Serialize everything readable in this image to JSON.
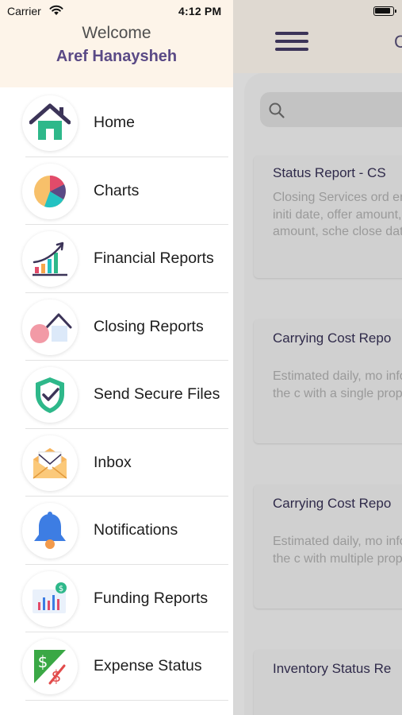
{
  "status_bar": {
    "carrier": "Carrier",
    "time": "4:12 PM"
  },
  "drawer": {
    "welcome": "Welcome",
    "user_name": "Aref Hanaysheh",
    "items": [
      {
        "label": "Home",
        "icon": "home-icon"
      },
      {
        "label": "Charts",
        "icon": "pie-chart-icon"
      },
      {
        "label": "Financial Reports",
        "icon": "bar-chart-growth-icon"
      },
      {
        "label": "Closing Reports",
        "icon": "house-closing-icon"
      },
      {
        "label": "Send Secure Files",
        "icon": "shield-check-icon"
      },
      {
        "label": "Inbox",
        "icon": "envelope-icon"
      },
      {
        "label": "Notifications",
        "icon": "bell-icon"
      },
      {
        "label": "Funding Reports",
        "icon": "funding-chart-icon"
      },
      {
        "label": "Expense Status",
        "icon": "expense-dollar-icon"
      }
    ]
  },
  "main": {
    "title": "C",
    "cards": [
      {
        "title": "Status Report - CS",
        "description": "Closing Services ord employee name, initi date, offer amount, a resale amount, sche close date."
      },
      {
        "title": "Carrying Cost Repo",
        "description": "Estimated daily, mo information on the c with a single proper"
      },
      {
        "title": "Carrying Cost Repo",
        "description": "Estimated daily, mo information on the c with multiple prope"
      },
      {
        "title": "Inventory Status Re",
        "description": ""
      }
    ]
  },
  "colors": {
    "accent": "#5a4a86",
    "header_bg": "#fdf4e9",
    "nav_icon": "#3c3458"
  }
}
